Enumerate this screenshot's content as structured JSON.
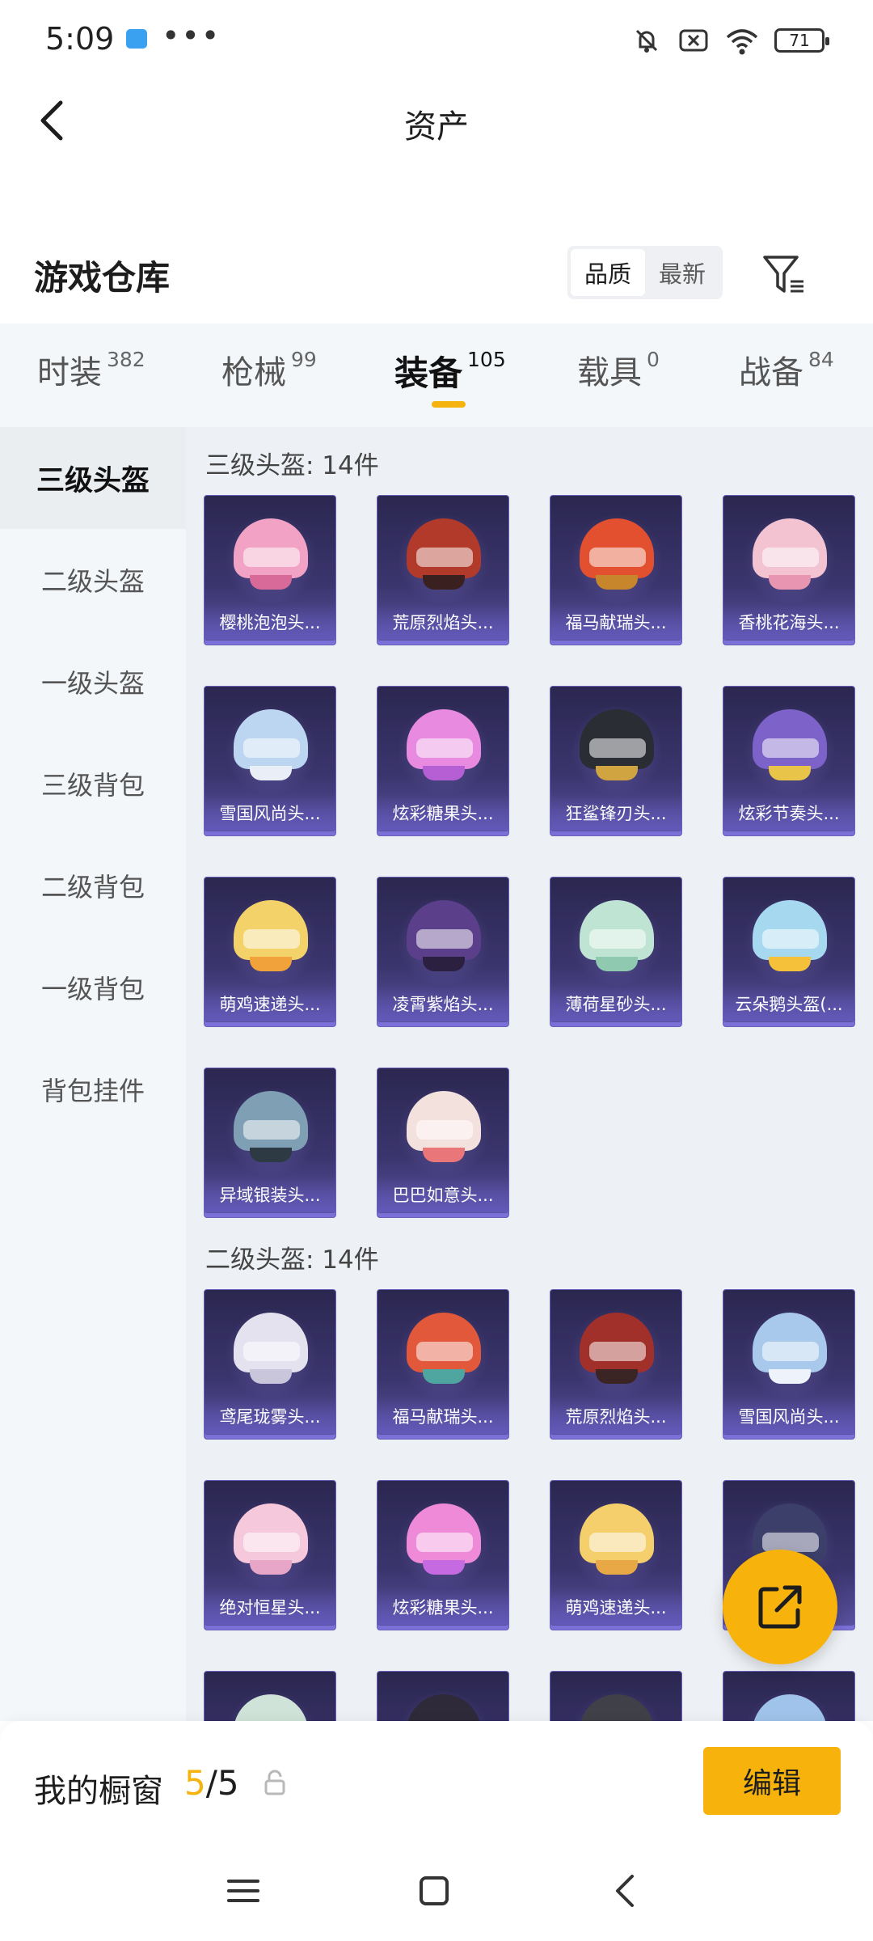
{
  "status_bar": {
    "time": "5:09",
    "more": "•••",
    "battery": "71"
  },
  "header": {
    "title": "资产"
  },
  "warehouse": {
    "title": "游戏仓库",
    "sort_options": [
      {
        "label": "品质",
        "active": true
      },
      {
        "label": "最新",
        "active": false
      }
    ]
  },
  "tabs": [
    {
      "label": "时装",
      "count": "382"
    },
    {
      "label": "枪械",
      "count": "99"
    },
    {
      "label": "装备",
      "count": "105",
      "active": true
    },
    {
      "label": "载具",
      "count": "0"
    },
    {
      "label": "战备",
      "count": "84"
    }
  ],
  "sidebar": [
    {
      "label": "三级头盔",
      "active": true
    },
    {
      "label": "二级头盔"
    },
    {
      "label": "一级头盔"
    },
    {
      "label": "三级背包"
    },
    {
      "label": "二级背包"
    },
    {
      "label": "一级背包"
    },
    {
      "label": "背包挂件"
    }
  ],
  "sections": [
    {
      "title": "三级头盔: 14件",
      "items": [
        {
          "name": "樱桃泡泡头...",
          "color": "#f2a2c4",
          "chin": "#d86a9a"
        },
        {
          "name": "荒原烈焰头...",
          "color": "#b23a2a",
          "chin": "#3b2020"
        },
        {
          "name": "福马献瑞头...",
          "color": "#e2502f",
          "chin": "#c7862c"
        },
        {
          "name": "香桃花海头...",
          "color": "#f3c3d2",
          "chin": "#e795b0"
        },
        {
          "name": "雪国风尚头...",
          "color": "#bcd6f2",
          "chin": "#e9eef7"
        },
        {
          "name": "炫彩糖果头...",
          "color": "#e78ae0",
          "chin": "#b65fd4"
        },
        {
          "name": "狂鲨锋刃头...",
          "color": "#2a2d33",
          "chin": "#d0a440"
        },
        {
          "name": "炫彩节奏头...",
          "color": "#7d63c9",
          "chin": "#e8c449"
        },
        {
          "name": "萌鸡速递头...",
          "color": "#f4d26a",
          "chin": "#f2a23a"
        },
        {
          "name": "凌霄紫焰头...",
          "color": "#5b3f8a",
          "chin": "#2b2040"
        },
        {
          "name": "薄荷星砂头...",
          "color": "#bfe4d4",
          "chin": "#8fcab0"
        },
        {
          "name": "云朵鹅头盔(...",
          "color": "#a6d8f0",
          "chin": "#f5c03a"
        },
        {
          "name": "异域银装头...",
          "color": "#7fa0b4",
          "chin": "#2d3a44"
        },
        {
          "name": "巴巴如意头...",
          "color": "#f3e1dd",
          "chin": "#e9777a"
        }
      ]
    },
    {
      "title": "二级头盔: 14件",
      "items": [
        {
          "name": "鸢尾珑雾头...",
          "color": "#e4e2ef",
          "chin": "#c9c6dc"
        },
        {
          "name": "福马献瑞头...",
          "color": "#e2583b",
          "chin": "#4fa6a0"
        },
        {
          "name": "荒原烈焰头...",
          "color": "#a2302a",
          "chin": "#3a2424"
        },
        {
          "name": "雪国风尚头...",
          "color": "#a9c9ec",
          "chin": "#eef2fa"
        },
        {
          "name": "绝对恒星头...",
          "color": "#f5c8dc",
          "chin": "#e7a6c8"
        },
        {
          "name": "炫彩糖果头...",
          "color": "#ef8ad8",
          "chin": "#c56ae0"
        },
        {
          "name": "萌鸡速递头...",
          "color": "#f4cf6c",
          "chin": "#e8a846"
        },
        {
          "name": "",
          "color": "#3c3f6a",
          "chin": "#b8bcd8"
        },
        {
          "name": "",
          "color": "#cfe3d8",
          "chin": "#9bc1b0"
        },
        {
          "name": "",
          "color": "#2e2a3a",
          "chin": "#f0f0f0"
        },
        {
          "name": "",
          "color": "#404048",
          "chin": "#d9d9d9"
        },
        {
          "name": "",
          "color": "#9fc3ea",
          "chin": "#eaf2fb"
        }
      ]
    }
  ],
  "showcase": {
    "label": "我的橱窗",
    "current": "5",
    "separator": "/",
    "total": "5",
    "edit_label": "编辑"
  },
  "colors": {
    "accent": "#f7b30b",
    "card_bg": "#3b356e"
  }
}
